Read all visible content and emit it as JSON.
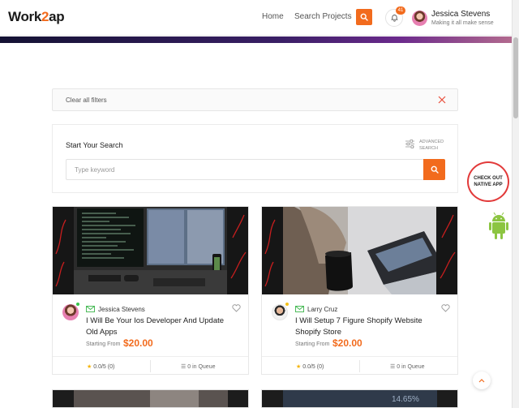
{
  "header": {
    "logo_left": "Work",
    "logo_mid": "2",
    "logo_right": "ap",
    "nav": {
      "home": "Home",
      "search_projects": "Search Projects"
    },
    "notifications_count": "41",
    "user": {
      "name": "Jessica Stevens",
      "tagline": "Making it all make sense"
    }
  },
  "filters": {
    "clear_label": "Clear all filters"
  },
  "search": {
    "title": "Start Your Search",
    "advanced_label": "Advanced Search",
    "placeholder": "Type keyword"
  },
  "cards": [
    {
      "seller": "Jessica Stevens",
      "title": "I Will Be Your Ios Developer And Update Old Apps",
      "starting_from": "Starting From",
      "price": "$20.00",
      "rating": "0.0/5 (0)",
      "queue": "0 in Queue",
      "status": "online"
    },
    {
      "seller": "Larry Cruz",
      "title": "I Will Setup 7 Figure Shopify Website Shopify Store",
      "starting_from": "Starting From",
      "price": "$20.00",
      "rating": "0.0/5 (0)",
      "queue": "0 in Queue",
      "status": "away"
    }
  ],
  "native_app": {
    "label": "CHECK OUT NATIVE APP"
  },
  "peek_text": "14.65%",
  "colors": {
    "accent": "#f26b1d",
    "online": "#39c34b",
    "away": "#f5c11a",
    "badge_ring": "#e23a3a"
  }
}
